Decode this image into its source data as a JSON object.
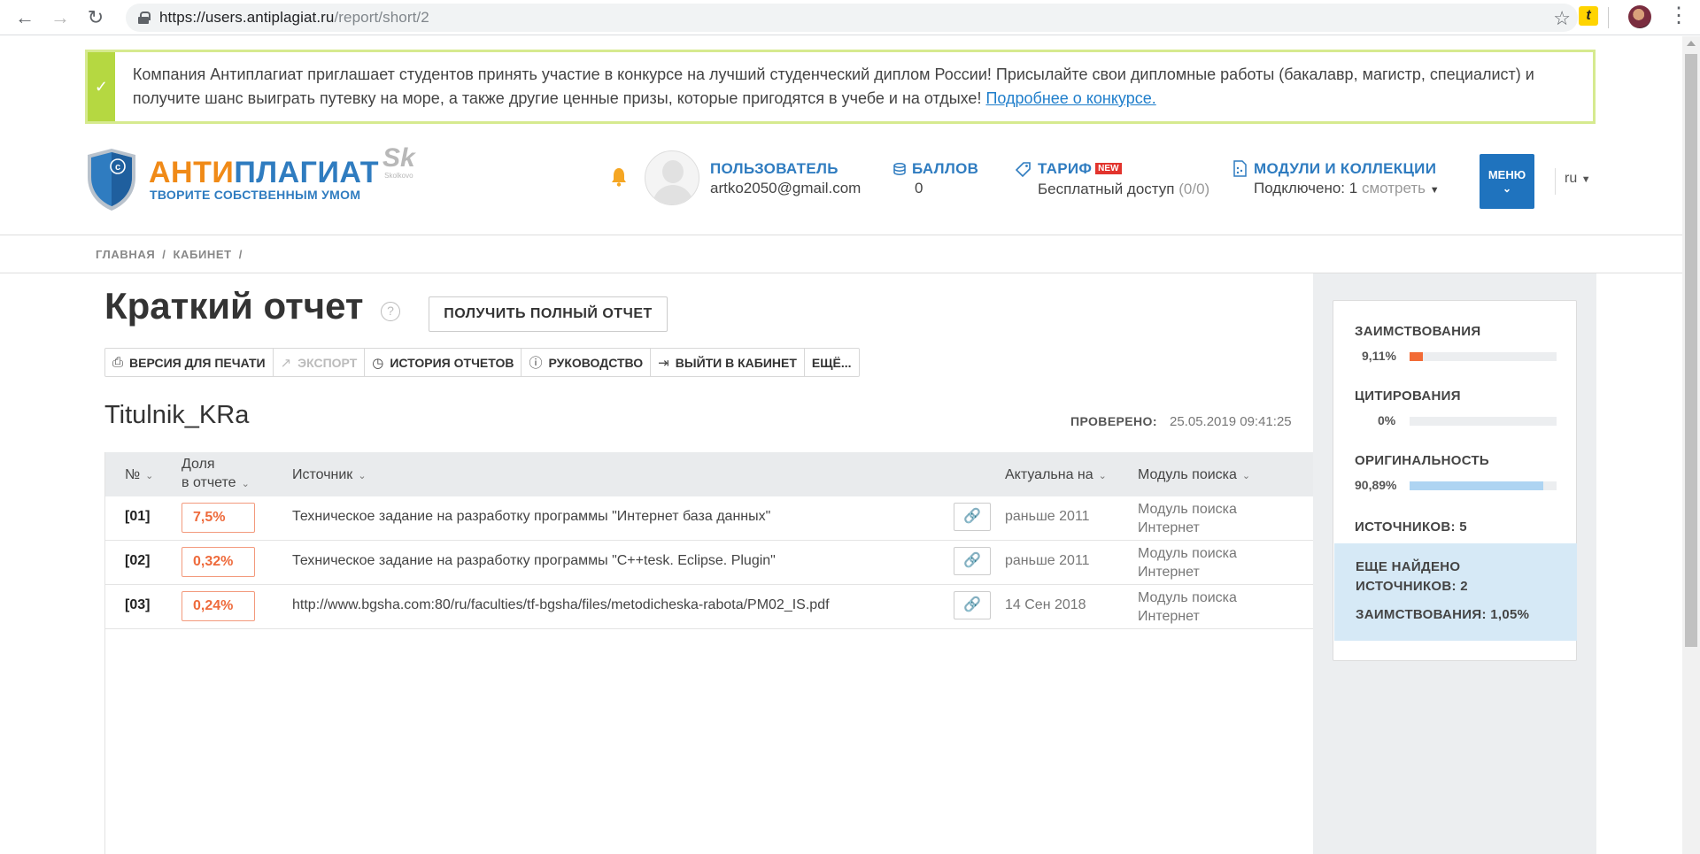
{
  "browser": {
    "url_host": "https://users.antiplagiat.ru",
    "url_path": "/report/short/2",
    "extension_label": "t"
  },
  "banner": {
    "text": "Компания Антиплагиат приглашает студентов принять участие в конкурсе на лучший студенческий диплом России! Присылайте свои дипломные работы (бакалавр, магистр, специалист) и получите шанс выиграть путевку на море, а также другие ценные призы, которые пригодятся в учебе и на отдыхе! ",
    "link": "Подробнее о конкурсе."
  },
  "logo": {
    "title_part1": "АНТИ",
    "title_part2": "ПЛАГИАТ",
    "slogan": "ТВОРИТЕ СОБСТВЕННЫМ УМОМ",
    "partner_mark": "Sk",
    "partner_name": "Skolkovo"
  },
  "header": {
    "user_label": "ПОЛЬЗОВАТЕЛЬ",
    "user_email": "artko2050@gmail.com",
    "points_label": "БАЛЛОВ",
    "points_value": "0",
    "tariff_label": "ТАРИФ",
    "tariff_badge": "NEW",
    "tariff_value": "Бесплатный доступ",
    "tariff_quota": "(0/0)",
    "modules_label": "МОДУЛИ И КОЛЛЕКЦИИ",
    "modules_connected": "Подключено: 1",
    "modules_view": "смотреть",
    "menu_label": "МЕНЮ",
    "lang": "ru"
  },
  "breadcrumb": [
    "ГЛАВНАЯ",
    "/",
    "КАБИНЕТ",
    "/"
  ],
  "report": {
    "title": "Краткий отчет",
    "help": "?",
    "full_report_button": "ПОЛУЧИТЬ ПОЛНЫЙ ОТЧЕТ",
    "toolbar": {
      "print": "ВЕРСИЯ ДЛЯ ПЕЧАТИ",
      "export": "ЭКСПОРТ",
      "history": "ИСТОРИЯ ОТЧЕТОВ",
      "guide": "РУКОВОДСТВО",
      "exit": "ВЫЙТИ В КАБИНЕТ",
      "more": "ЕЩЁ..."
    },
    "document_name": "Titulnik_KRa",
    "checked_label": "ПРОВЕРЕНО:",
    "checked_value": "25.05.2019 09:41:25"
  },
  "table": {
    "headers": {
      "num": "№",
      "share_line1": "Доля",
      "share_line2": "в отчете",
      "source": "Источник",
      "actual": "Актуальна на",
      "module": "Модуль поиска"
    },
    "rows": [
      {
        "num": "[01]",
        "share": "7,5%",
        "source": "Техническое задание на разработку программы \"Интернет база данных\"",
        "date": "раньше 2011",
        "module_line1": "Модуль поиска",
        "module_line2": "Интернет"
      },
      {
        "num": "[02]",
        "share": "0,32%",
        "source": "Техническое задание на разработку программы \"C++tesk. Eclipse. Plugin\"",
        "date": "раньше 2011",
        "module_line1": "Модуль поиска",
        "module_line2": "Интернет"
      },
      {
        "num": "[03]",
        "share": "0,24%",
        "source": "http://www.bgsha.com:80/ru/faculties/tf-bgsha/files/metodicheska-rabota/PM02_IS.pdf",
        "date": "14 Сен 2018",
        "module_line1": "Модуль поиска",
        "module_line2": "Интернет"
      }
    ]
  },
  "summary": {
    "borrowing_label": "ЗАИМСТВОВАНИЯ",
    "borrowing_value": "9,11%",
    "borrowing_fraction": 0.0911,
    "citation_label": "ЦИТИРОВАНИЯ",
    "citation_value": "0%",
    "citation_fraction": 0,
    "originality_label": "ОРИГИНАЛЬНОСТЬ",
    "originality_value": "90,89%",
    "originality_fraction": 0.9089,
    "sources_label": "ИСТОЧНИКОВ:",
    "sources_value": "5",
    "more_found_line1": "ЕЩЕ НАЙДЕНО",
    "more_found_line2": "ИСТОЧНИКОВ:",
    "more_found_value": "2",
    "more_borrowing_label": "ЗАИМСТВОВАНИЯ:",
    "more_borrowing_value": "1,05%",
    "colors": {
      "borrowing": "#f26b36",
      "citation": "#5cb85c",
      "originality": "#aed4f2"
    }
  }
}
